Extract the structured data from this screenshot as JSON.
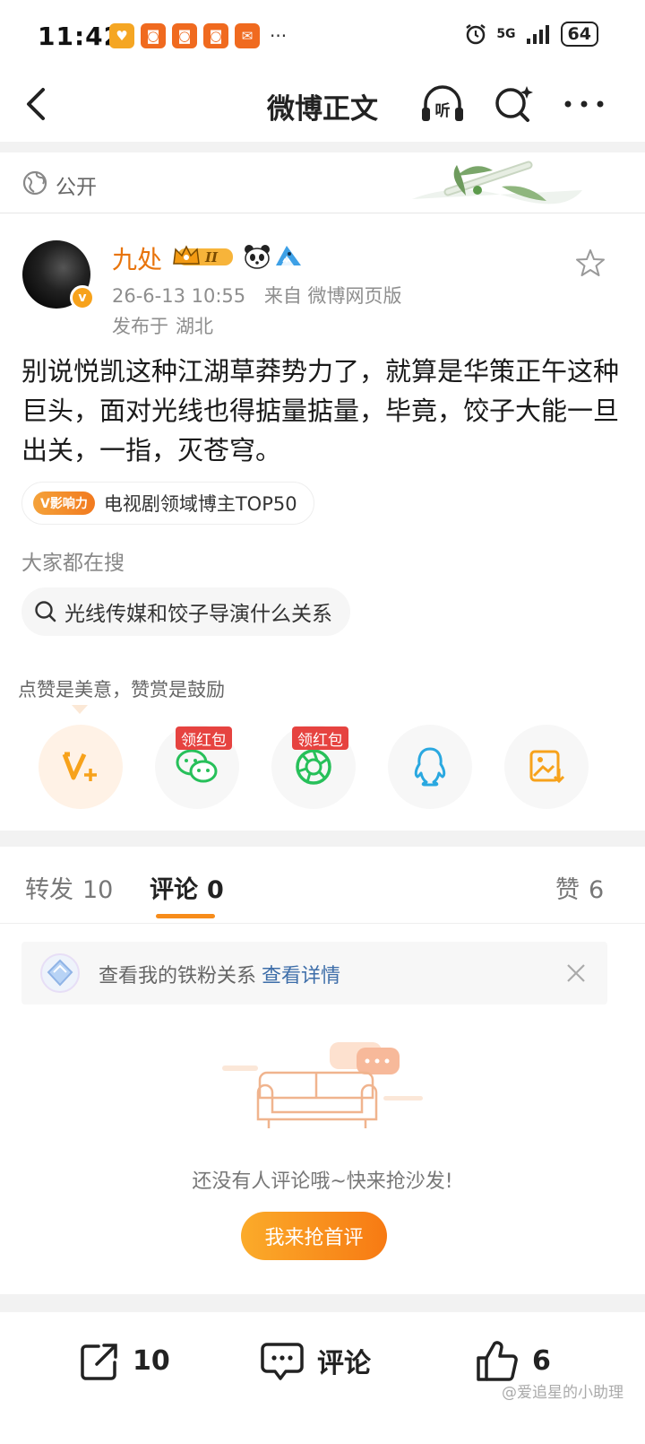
{
  "status_bar": {
    "time": "11:42",
    "notification_icons": [
      "heart-app-icon",
      "app-icon",
      "app-icon",
      "app-icon",
      "envelope-app-icon"
    ],
    "more": "···",
    "network": "5G",
    "battery": "64"
  },
  "nav": {
    "title": "微博正文",
    "listen_label": "听"
  },
  "visibility": {
    "label": "公开"
  },
  "post": {
    "username": "九处",
    "level": "II",
    "timestamp": "26-6-13 10:55",
    "source": "来自 微博网页版",
    "location_prefix": "发布于",
    "location": "湖北",
    "text": "别说悦凯这种江湖草莽势力了，就算是华策正午这种巨头，面对光线也得掂量掂量，毕竟，饺子大能一旦出关，一指，灭苍穹。",
    "influence_logo": "V影响力",
    "influence_text": "电视剧领域博主TOP50"
  },
  "search": {
    "heading": "大家都在搜",
    "query": "光线传媒和饺子导演什么关系"
  },
  "reward": {
    "tip": "点赞是美意，赞赏是鼓励",
    "red_packet_label": "领红包"
  },
  "tabs": {
    "repost_label": "转发",
    "repost_count": "10",
    "comment_label": "评论",
    "comment_count": "0",
    "like_label": "赞",
    "like_count": "6"
  },
  "ironfan": {
    "text": "查看我的铁粉关系",
    "link": "查看详情"
  },
  "empty": {
    "text": "还没有人评论哦~快来抢沙发!",
    "button": "我来抢首评"
  },
  "bottom_bar": {
    "repost_count": "10",
    "comment_label": "评论",
    "like_count": "6"
  },
  "watermark": "@爱追星的小助理",
  "colors": {
    "brand_orange": "#f78c1a",
    "username": "#e8740c",
    "link_blue": "#3e6ea9",
    "red_packet": "#e64340"
  }
}
